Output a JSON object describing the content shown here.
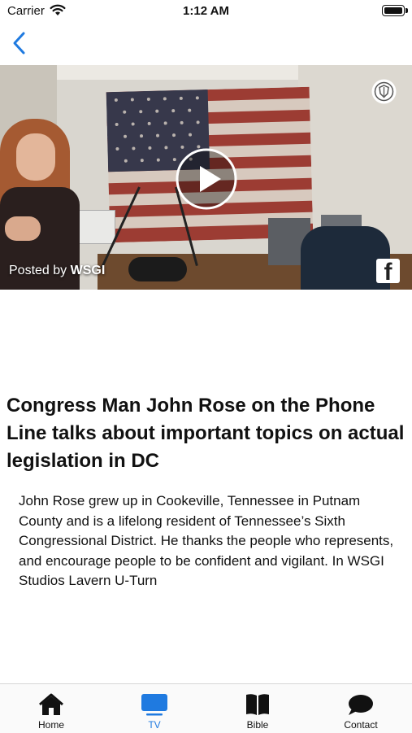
{
  "status_bar": {
    "carrier": "Carrier",
    "time": "1:12 AM"
  },
  "nav": {
    "back_icon": "chevron-left-icon",
    "accent_color": "#1f7ae0"
  },
  "video": {
    "posted_prefix": "Posted by ",
    "posted_by": "WSGI",
    "play_icon": "play-icon",
    "share_icon": "facebook-icon",
    "badge_icon": "shield-badge-icon"
  },
  "article": {
    "title": "Congress Man John Rose on the Phone Line talks about important topics on actual legislation in DC",
    "body": "John Rose grew up in Cookeville, Tennessee in Putnam County and is a lifelong resident of Tennessee’s Sixth Congressional District.  He thanks the people who represents, and encourage people to be confident and vigilant.  In WSGI Studios Lavern U-Turn"
  },
  "tabs": [
    {
      "label": "Home",
      "icon": "home-icon",
      "active": false
    },
    {
      "label": "TV",
      "icon": "tv-icon",
      "active": true
    },
    {
      "label": "Bible",
      "icon": "book-icon",
      "active": false
    },
    {
      "label": "Contact",
      "icon": "chat-bubble-icon",
      "active": false
    }
  ]
}
